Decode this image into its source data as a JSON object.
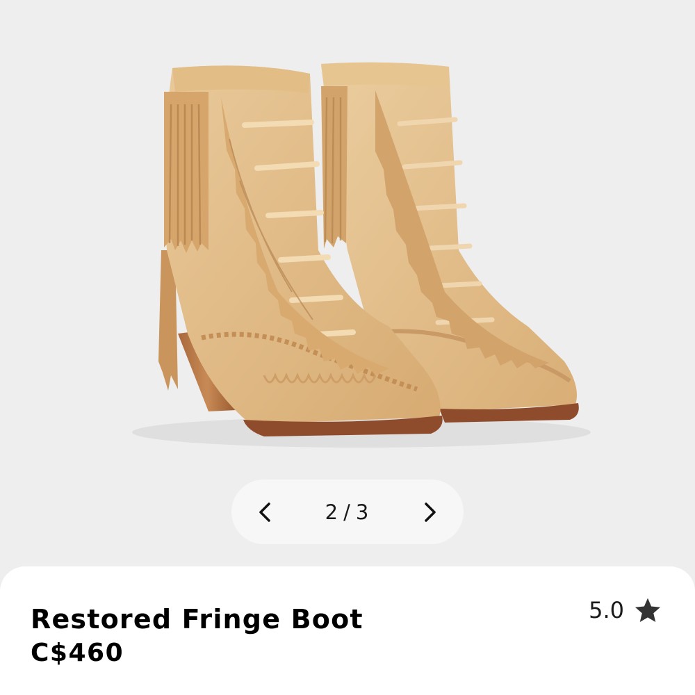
{
  "gallery": {
    "image_alt": "Restored Fringe Boot",
    "current_index": "2",
    "separator": "/",
    "total": "3",
    "prev_icon": "chevron-left-icon",
    "next_icon": "chevron-right-icon"
  },
  "product": {
    "title": "Restored Fringe Boot",
    "price": "C$460",
    "rating": "5.0",
    "rating_icon": "star-icon"
  },
  "colors": {
    "background": "#eeeeee",
    "panel": "#ffffff",
    "text": "#000000",
    "boot_suede": "#e3be8a",
    "sole": "#8f4c2d"
  }
}
